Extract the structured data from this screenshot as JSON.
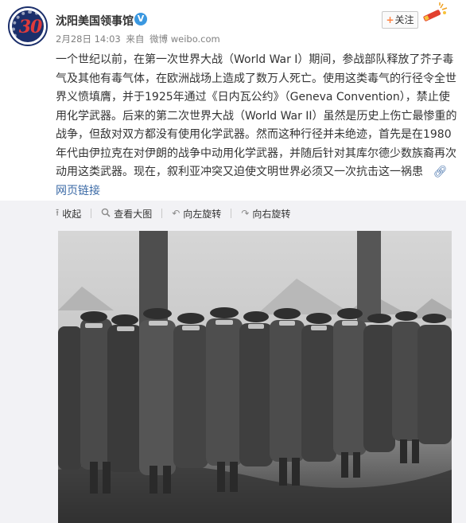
{
  "user": {
    "name": "沈阳美国领事馆",
    "avatar_text": "30",
    "verified_mark": "V"
  },
  "meta": {
    "date": "2月28日 14:03",
    "source_prefix": "来自",
    "source": "微博 weibo.com"
  },
  "follow_button": {
    "plus": "+",
    "label": "关注"
  },
  "post": {
    "text_main": "一个世纪以前，在第一次世界大战（World War I）期间，参战部队释放了芥子毒气及其他有毒气体，在欧洲战场上造成了数万人死亡。使用这类毒气的行径令全世界义愤填膺，并于1925年通过《日内瓦公约》（Geneva Convention），禁止使用化学武器。后来的第二次世界大战（World War II）虽然是历史上伤亡最惨重的战争，但敌对双方都没有使用化学武器。然而这种行径并未绝迹，首先是在1980年代由伊拉克在对伊朗的战争中动用化学武器，并随后针对其库尔德少数族裔再次动用这类武器。现在，叙利亚冲突又迫使文明世界必须又一次抗击这一祸患",
    "web_link_label": "网页链接"
  },
  "toolbar": {
    "collapse": "收起",
    "view_large": "查看大图",
    "rotate_left": "向左旋转",
    "rotate_right": "向右旋转"
  },
  "icons": {
    "collapse": "collapse-icon",
    "view_large": "magnify-icon",
    "rotate_left": "rotate-left-icon",
    "rotate_right": "rotate-right-icon",
    "link": "link-icon"
  },
  "colors": {
    "accent_orange": "#eb7350",
    "link_blue": "#3b6aa6",
    "verified_blue": "#3b98e0",
    "media_bg": "#f2f2f5"
  }
}
